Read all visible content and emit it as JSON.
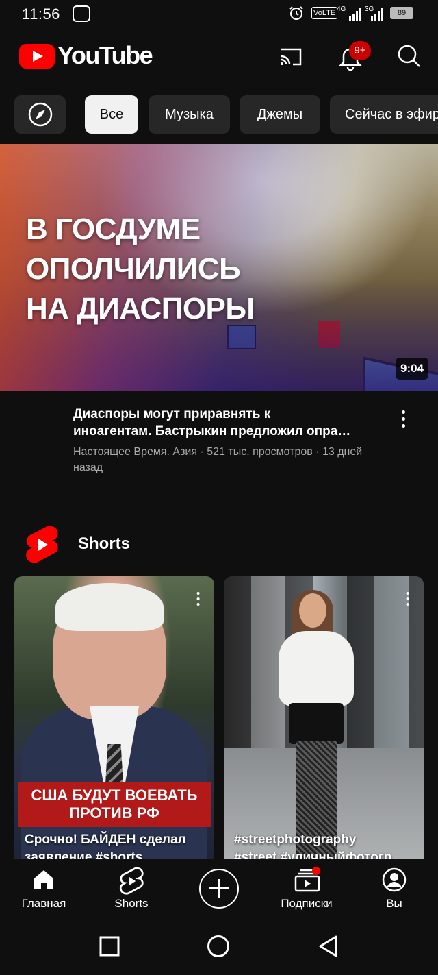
{
  "status_bar": {
    "time": "11:56",
    "volte": "VoLTE",
    "network": "4G",
    "network2": "3G",
    "battery": "89"
  },
  "header": {
    "logo_text": "YouTube",
    "notification_badge": "9+",
    "brand_color": "#ff0000"
  },
  "chips": {
    "explore_icon": "compass-icon",
    "items": [
      "Все",
      "Музыка",
      "Джемы",
      "Сейчас в эфире"
    ]
  },
  "video": {
    "thumbnail_lines": [
      "В ГОСДУМЕ",
      "ОПОЛЧИЛИСЬ",
      "НА ДИАСПОРЫ"
    ],
    "duration": "9:04",
    "title_line1": "Диаспоры могут приравнять к",
    "title_line2": "иноагентам. Бастрыкин предложил опра…",
    "meta": "Настоящее Время. Азия · 521 тыс. просмотров · 13 дней назад"
  },
  "shorts": {
    "section_title": "Shorts",
    "items": [
      {
        "banner": "США БУДУТ ВОЕВАТЬ ПРОТИВ РФ",
        "caption_line1": "Срочно! БАЙДЕН сделал",
        "caption_line2": "заявление #shorts"
      },
      {
        "caption_line1": "#streetphotography",
        "caption_line2": "#street #уличныйфотогр"
      }
    ]
  },
  "bottom_nav": {
    "home": "Главная",
    "shorts": "Shorts",
    "subscriptions": "Подписки",
    "you": "Вы"
  }
}
